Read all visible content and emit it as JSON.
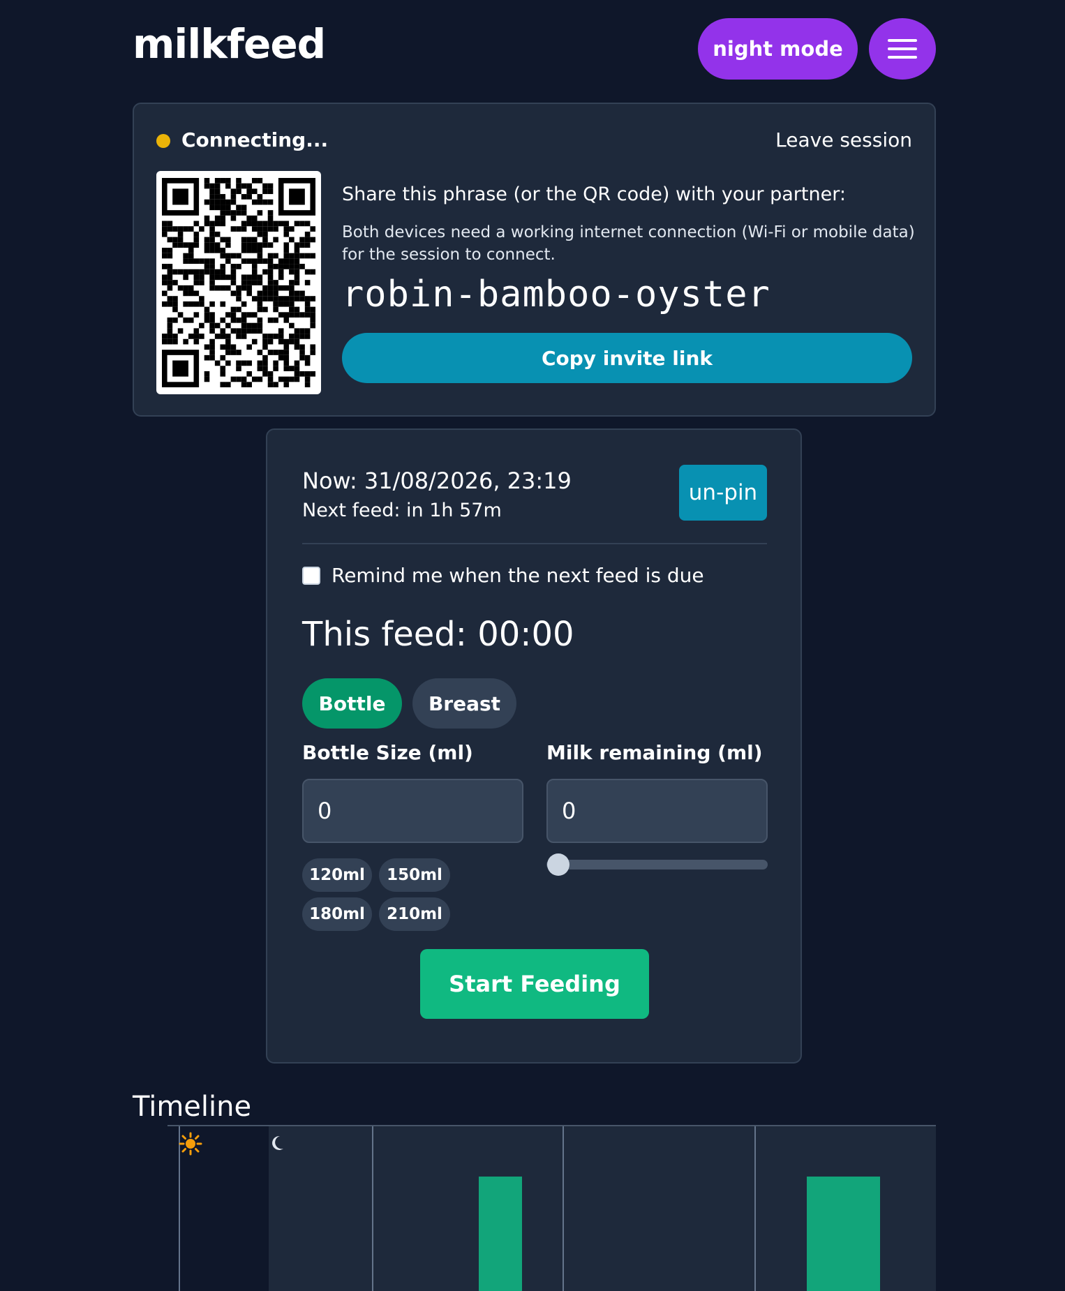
{
  "app": {
    "title": "milkfeed",
    "night_mode_label": "night mode",
    "menu_icon": "hamburger-icon"
  },
  "session": {
    "status": "Connecting...",
    "status_color": "#eab308",
    "leave_label": "Leave session",
    "share_title": "Share this phrase (or the QR code) with your partner:",
    "share_description": "Both devices need a working internet connection (Wi-Fi or mobile data) for the session to connect.",
    "phrase": "robin-bamboo-oyster",
    "copy_label": "Copy invite link"
  },
  "feed": {
    "now": "Now: 31/08/2026, 23:19",
    "next_feed": "Next feed: in 1h 57m",
    "unpin_label": "un-pin",
    "remind_label": "Remind me when the next feed is due",
    "remind_checked": false,
    "this_feed": "This feed: 00:00",
    "types": [
      {
        "label": "Bottle",
        "active": true
      },
      {
        "label": "Breast",
        "active": false
      }
    ],
    "bottle_size_label": "Bottle Size (ml)",
    "bottle_size_value": "0",
    "milk_remaining_label": "Milk remaining (ml)",
    "milk_remaining_value": "0",
    "milk_remaining_fraction": 0,
    "presets": [
      "120ml",
      "150ml",
      "180ml",
      "210ml"
    ],
    "start_label": "Start Feeding"
  },
  "timeline": {
    "title": "Timeline",
    "icons": [
      "sun-icon",
      "moon-icon"
    ]
  },
  "colors": {
    "background": "#0f172a",
    "card": "#1e293b",
    "accent_purple": "#9333ea",
    "accent_cyan": "#0891b2",
    "accent_green": "#10b981"
  }
}
